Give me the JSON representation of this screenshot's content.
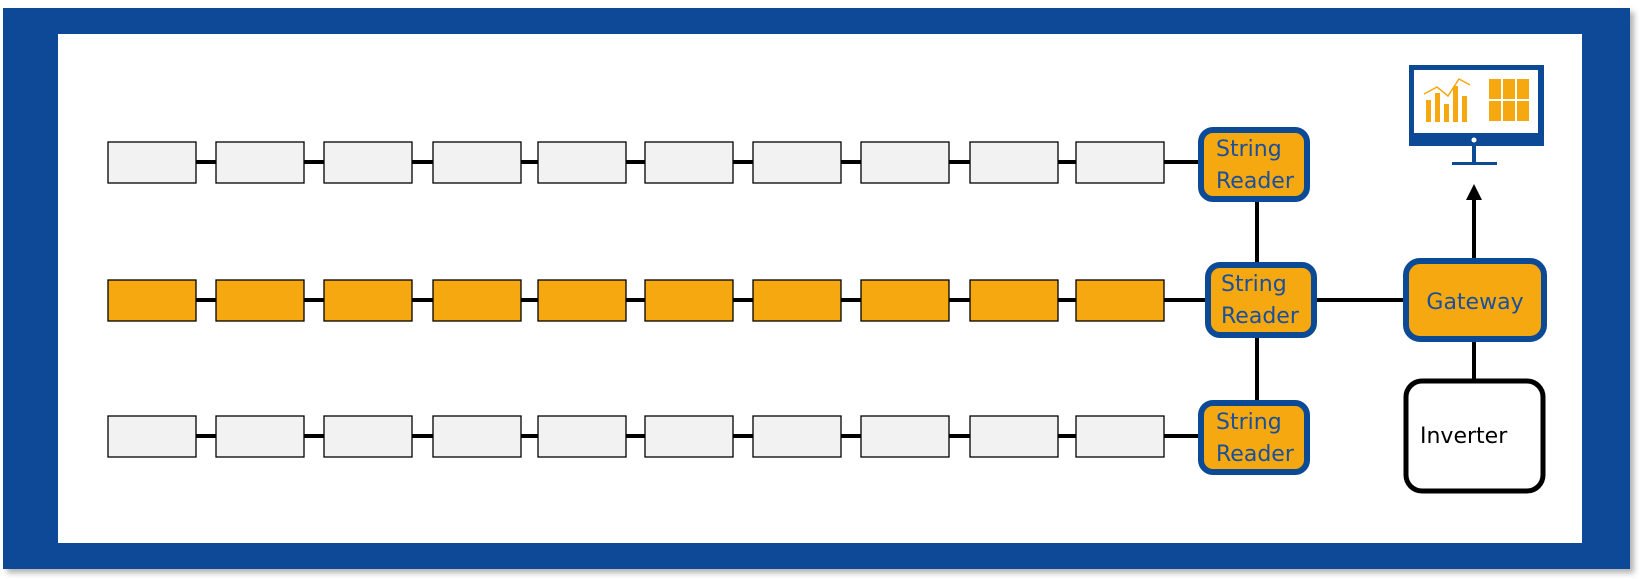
{
  "colors": {
    "frame": "#0D4A96",
    "accent": "#F5A80F",
    "module_inactive": "#F2F2F2",
    "text_blue": "#1A4F9C",
    "line": "#000000"
  },
  "strings": [
    {
      "active": false,
      "modules": 10,
      "reader": {
        "line1": "String",
        "line2": "Reader"
      }
    },
    {
      "active": true,
      "modules": 10,
      "reader": {
        "line1": "String",
        "line2": "Reader"
      }
    },
    {
      "active": false,
      "modules": 10,
      "reader": {
        "line1": "String",
        "line2": "Reader"
      }
    }
  ],
  "gateway": {
    "label": "Gateway"
  },
  "inverter": {
    "label": "Inverter"
  },
  "monitor": {
    "icon": "dashboard-monitor-icon"
  }
}
